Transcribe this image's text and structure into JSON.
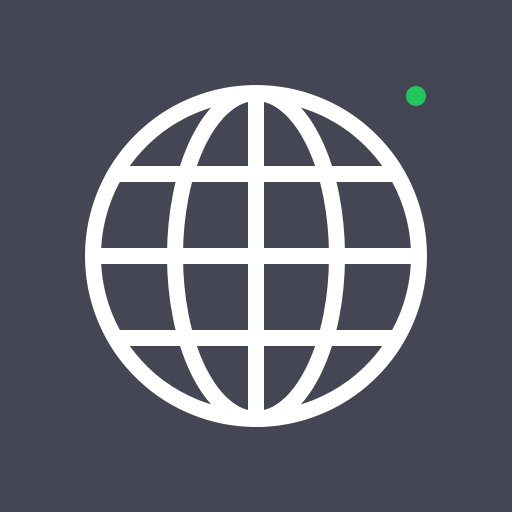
{
  "app_icon": {
    "icon": "globe-icon",
    "background_color": "#444654",
    "icon_color": "#ffffff"
  },
  "status_indicator": {
    "state": "online",
    "color": "#22c55e"
  }
}
